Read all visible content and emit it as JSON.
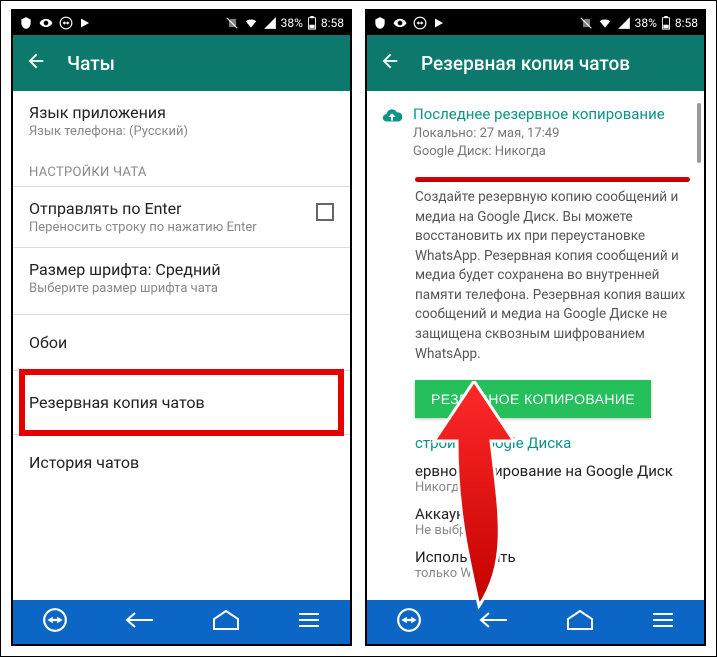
{
  "statusbar": {
    "battery_pct": "38%",
    "time": "8:58"
  },
  "left": {
    "title": "Чаты",
    "lang_item": {
      "primary": "Язык приложения",
      "secondary": "Язык телефона: (Русский)"
    },
    "section_chat_settings": "НАСТРОЙКИ ЧАТА",
    "enter_send": {
      "primary": "Отправлять по Enter",
      "secondary": "Переносить строку по нажатию Enter"
    },
    "font_size": {
      "primary": "Размер шрифта: Средний",
      "secondary": "Выберите размер шрифта чата"
    },
    "wallpaper": "Обои",
    "backup": "Резервная копия чатов",
    "history": "История чатов"
  },
  "right": {
    "title": "Резервная копия чатов",
    "last_backup_title": "Последнее резервное копирование",
    "local_line": "Локально: 27 мая, 17:49",
    "gdrive_line": "Google Диск: Никогда",
    "desc": "Создайте резервную копию сообщений и медиа на Google Диск. Вы можете восстановить их при переустановке WhatsApp. Резервная копия сообщений и медиа будет сохранена во внутренней памяти телефона. Резервная копия ваших сообщений и медиа на Google Диске не защищена сквозным шифрованием WhatsApp.",
    "backup_button": "РЕЗЕРВНОЕ КОПИРОВАНИЕ",
    "gdrive_settings_title": "стройки Google Диска",
    "gdrive_backup": {
      "primary": "ервное копирование на Google Диск",
      "secondary": "Никогда"
    },
    "account": {
      "primary": "Аккаунт",
      "secondary": "Не выбрано"
    },
    "use": {
      "primary": "Использовать",
      "secondary": "только Wi-Fi"
    }
  }
}
